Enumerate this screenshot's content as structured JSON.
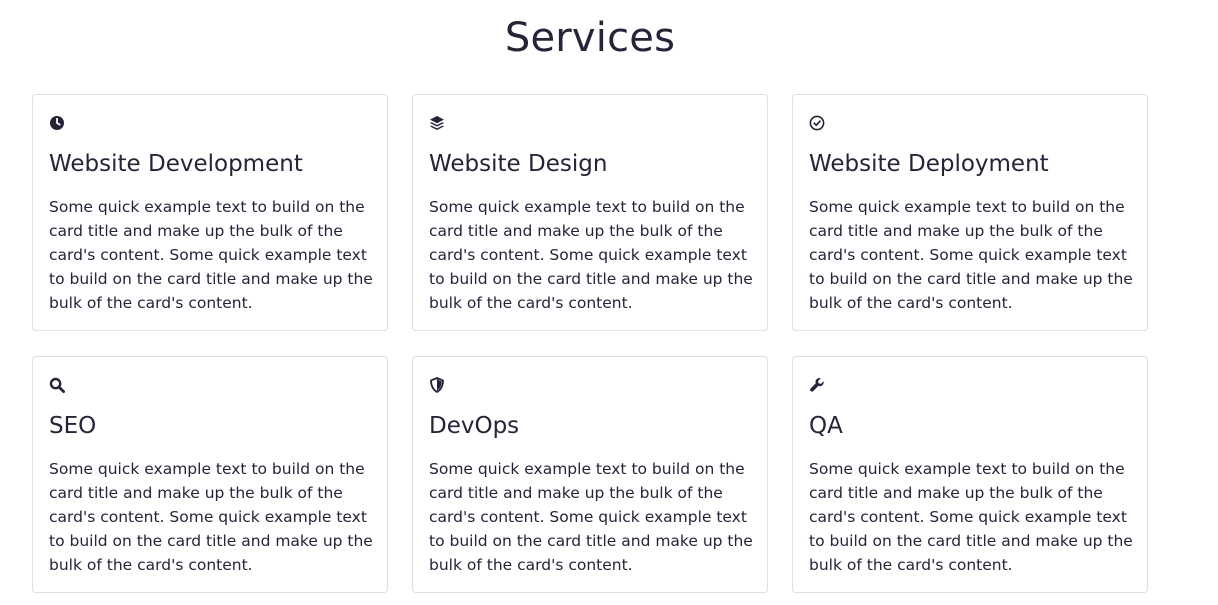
{
  "page": {
    "title": "Services"
  },
  "cards": [
    {
      "icon": "clock-icon",
      "title": "Website Development",
      "text": "Some quick example text to build on the card title and make up the bulk of the card's content. Some quick example text to build on the card title and make up the bulk of the card's content."
    },
    {
      "icon": "layers-icon",
      "title": "Website Design",
      "text": "Some quick example text to build on the card title and make up the bulk of the card's content. Some quick example text to build on the card title and make up the bulk of the card's content."
    },
    {
      "icon": "check-circle-icon",
      "title": "Website Deployment",
      "text": "Some quick example text to build on the card title and make up the bulk of the card's content. Some quick example text to build on the card title and make up the bulk of the card's content."
    },
    {
      "icon": "search-icon",
      "title": "SEO",
      "text": "Some quick example text to build on the card title and make up the bulk of the card's content. Some quick example text to build on the card title and make up the bulk of the card's content."
    },
    {
      "icon": "shield-icon",
      "title": "DevOps",
      "text": "Some quick example text to build on the card title and make up the bulk of the card's content. Some quick example text to build on the card title and make up the bulk of the card's content."
    },
    {
      "icon": "wrench-icon",
      "title": "QA",
      "text": "Some quick example text to build on the card title and make up the bulk of the card's content. Some quick example text to build on the card title and make up the bulk of the card's content."
    }
  ],
  "colors": {
    "text": "#272338",
    "card_border": "#dfe0e3",
    "background": "#ffffff"
  }
}
